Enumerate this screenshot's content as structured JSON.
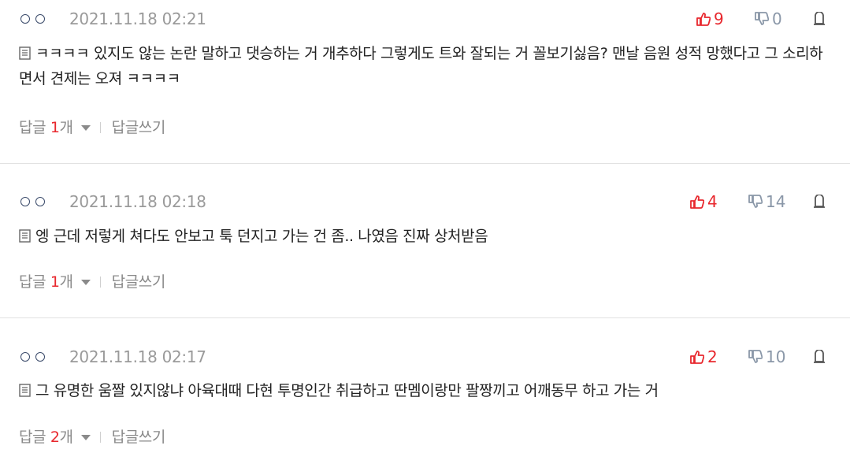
{
  "comments": [
    {
      "date": "2021.11.18 02:21",
      "likes": "9",
      "dislikes": "0",
      "text": "ㅋㅋㅋㅋ 있지도 않는 논란 말하고 댓승하는 거 개추하다 그렇게도 트와 잘되는 거 꼴보기싫음? 맨날 음원 성적 망했다고 그 소리하면서 견제는 오져 ㅋㅋㅋㅋ",
      "reply_label": "답글",
      "reply_count": "1",
      "reply_unit": "개",
      "write_reply": "답글쓰기"
    },
    {
      "date": "2021.11.18 02:18",
      "likes": "4",
      "dislikes": "14",
      "text": "엥 근데 저렇게 쳐다도 안보고 툭 던지고 가는 건 좀.. 나였음 진짜 상처받음",
      "reply_label": "답글",
      "reply_count": "1",
      "reply_unit": "개",
      "write_reply": "답글쓰기"
    },
    {
      "date": "2021.11.18 02:17",
      "likes": "2",
      "dislikes": "10",
      "text": "그 유명한 움짤 있지않냐 아육대때 다현 투명인간 취급하고 딴멤이랑만 팔짱끼고 어깨동무 하고 가는 거",
      "reply_label": "답글",
      "reply_count": "2",
      "reply_unit": "개",
      "write_reply": "답글쓰기"
    }
  ],
  "colors": {
    "like": "#e8282e",
    "dislike": "#8a97a8",
    "meta": "#9a9a9a"
  },
  "icons": {
    "anon": "anonymous-circles-icon",
    "like": "thumbs-up-icon",
    "dislike": "thumbs-down-icon",
    "report": "report-icon",
    "text": "document-icon",
    "expand": "caret-down-icon"
  }
}
